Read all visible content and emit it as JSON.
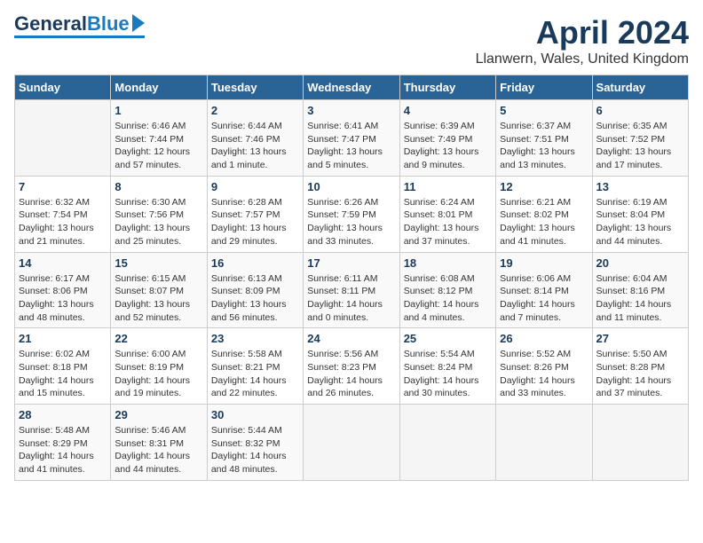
{
  "header": {
    "logo_general": "General",
    "logo_blue": "Blue",
    "month": "April 2024",
    "location": "Llanwern, Wales, United Kingdom"
  },
  "days_of_week": [
    "Sunday",
    "Monday",
    "Tuesday",
    "Wednesday",
    "Thursday",
    "Friday",
    "Saturday"
  ],
  "weeks": [
    [
      {
        "day": "",
        "info": ""
      },
      {
        "day": "1",
        "info": "Sunrise: 6:46 AM\nSunset: 7:44 PM\nDaylight: 12 hours\nand 57 minutes."
      },
      {
        "day": "2",
        "info": "Sunrise: 6:44 AM\nSunset: 7:46 PM\nDaylight: 13 hours\nand 1 minute."
      },
      {
        "day": "3",
        "info": "Sunrise: 6:41 AM\nSunset: 7:47 PM\nDaylight: 13 hours\nand 5 minutes."
      },
      {
        "day": "4",
        "info": "Sunrise: 6:39 AM\nSunset: 7:49 PM\nDaylight: 13 hours\nand 9 minutes."
      },
      {
        "day": "5",
        "info": "Sunrise: 6:37 AM\nSunset: 7:51 PM\nDaylight: 13 hours\nand 13 minutes."
      },
      {
        "day": "6",
        "info": "Sunrise: 6:35 AM\nSunset: 7:52 PM\nDaylight: 13 hours\nand 17 minutes."
      }
    ],
    [
      {
        "day": "7",
        "info": "Sunrise: 6:32 AM\nSunset: 7:54 PM\nDaylight: 13 hours\nand 21 minutes."
      },
      {
        "day": "8",
        "info": "Sunrise: 6:30 AM\nSunset: 7:56 PM\nDaylight: 13 hours\nand 25 minutes."
      },
      {
        "day": "9",
        "info": "Sunrise: 6:28 AM\nSunset: 7:57 PM\nDaylight: 13 hours\nand 29 minutes."
      },
      {
        "day": "10",
        "info": "Sunrise: 6:26 AM\nSunset: 7:59 PM\nDaylight: 13 hours\nand 33 minutes."
      },
      {
        "day": "11",
        "info": "Sunrise: 6:24 AM\nSunset: 8:01 PM\nDaylight: 13 hours\nand 37 minutes."
      },
      {
        "day": "12",
        "info": "Sunrise: 6:21 AM\nSunset: 8:02 PM\nDaylight: 13 hours\nand 41 minutes."
      },
      {
        "day": "13",
        "info": "Sunrise: 6:19 AM\nSunset: 8:04 PM\nDaylight: 13 hours\nand 44 minutes."
      }
    ],
    [
      {
        "day": "14",
        "info": "Sunrise: 6:17 AM\nSunset: 8:06 PM\nDaylight: 13 hours\nand 48 minutes."
      },
      {
        "day": "15",
        "info": "Sunrise: 6:15 AM\nSunset: 8:07 PM\nDaylight: 13 hours\nand 52 minutes."
      },
      {
        "day": "16",
        "info": "Sunrise: 6:13 AM\nSunset: 8:09 PM\nDaylight: 13 hours\nand 56 minutes."
      },
      {
        "day": "17",
        "info": "Sunrise: 6:11 AM\nSunset: 8:11 PM\nDaylight: 14 hours\nand 0 minutes."
      },
      {
        "day": "18",
        "info": "Sunrise: 6:08 AM\nSunset: 8:12 PM\nDaylight: 14 hours\nand 4 minutes."
      },
      {
        "day": "19",
        "info": "Sunrise: 6:06 AM\nSunset: 8:14 PM\nDaylight: 14 hours\nand 7 minutes."
      },
      {
        "day": "20",
        "info": "Sunrise: 6:04 AM\nSunset: 8:16 PM\nDaylight: 14 hours\nand 11 minutes."
      }
    ],
    [
      {
        "day": "21",
        "info": "Sunrise: 6:02 AM\nSunset: 8:18 PM\nDaylight: 14 hours\nand 15 minutes."
      },
      {
        "day": "22",
        "info": "Sunrise: 6:00 AM\nSunset: 8:19 PM\nDaylight: 14 hours\nand 19 minutes."
      },
      {
        "day": "23",
        "info": "Sunrise: 5:58 AM\nSunset: 8:21 PM\nDaylight: 14 hours\nand 22 minutes."
      },
      {
        "day": "24",
        "info": "Sunrise: 5:56 AM\nSunset: 8:23 PM\nDaylight: 14 hours\nand 26 minutes."
      },
      {
        "day": "25",
        "info": "Sunrise: 5:54 AM\nSunset: 8:24 PM\nDaylight: 14 hours\nand 30 minutes."
      },
      {
        "day": "26",
        "info": "Sunrise: 5:52 AM\nSunset: 8:26 PM\nDaylight: 14 hours\nand 33 minutes."
      },
      {
        "day": "27",
        "info": "Sunrise: 5:50 AM\nSunset: 8:28 PM\nDaylight: 14 hours\nand 37 minutes."
      }
    ],
    [
      {
        "day": "28",
        "info": "Sunrise: 5:48 AM\nSunset: 8:29 PM\nDaylight: 14 hours\nand 41 minutes."
      },
      {
        "day": "29",
        "info": "Sunrise: 5:46 AM\nSunset: 8:31 PM\nDaylight: 14 hours\nand 44 minutes."
      },
      {
        "day": "30",
        "info": "Sunrise: 5:44 AM\nSunset: 8:32 PM\nDaylight: 14 hours\nand 48 minutes."
      },
      {
        "day": "",
        "info": ""
      },
      {
        "day": "",
        "info": ""
      },
      {
        "day": "",
        "info": ""
      },
      {
        "day": "",
        "info": ""
      }
    ]
  ]
}
